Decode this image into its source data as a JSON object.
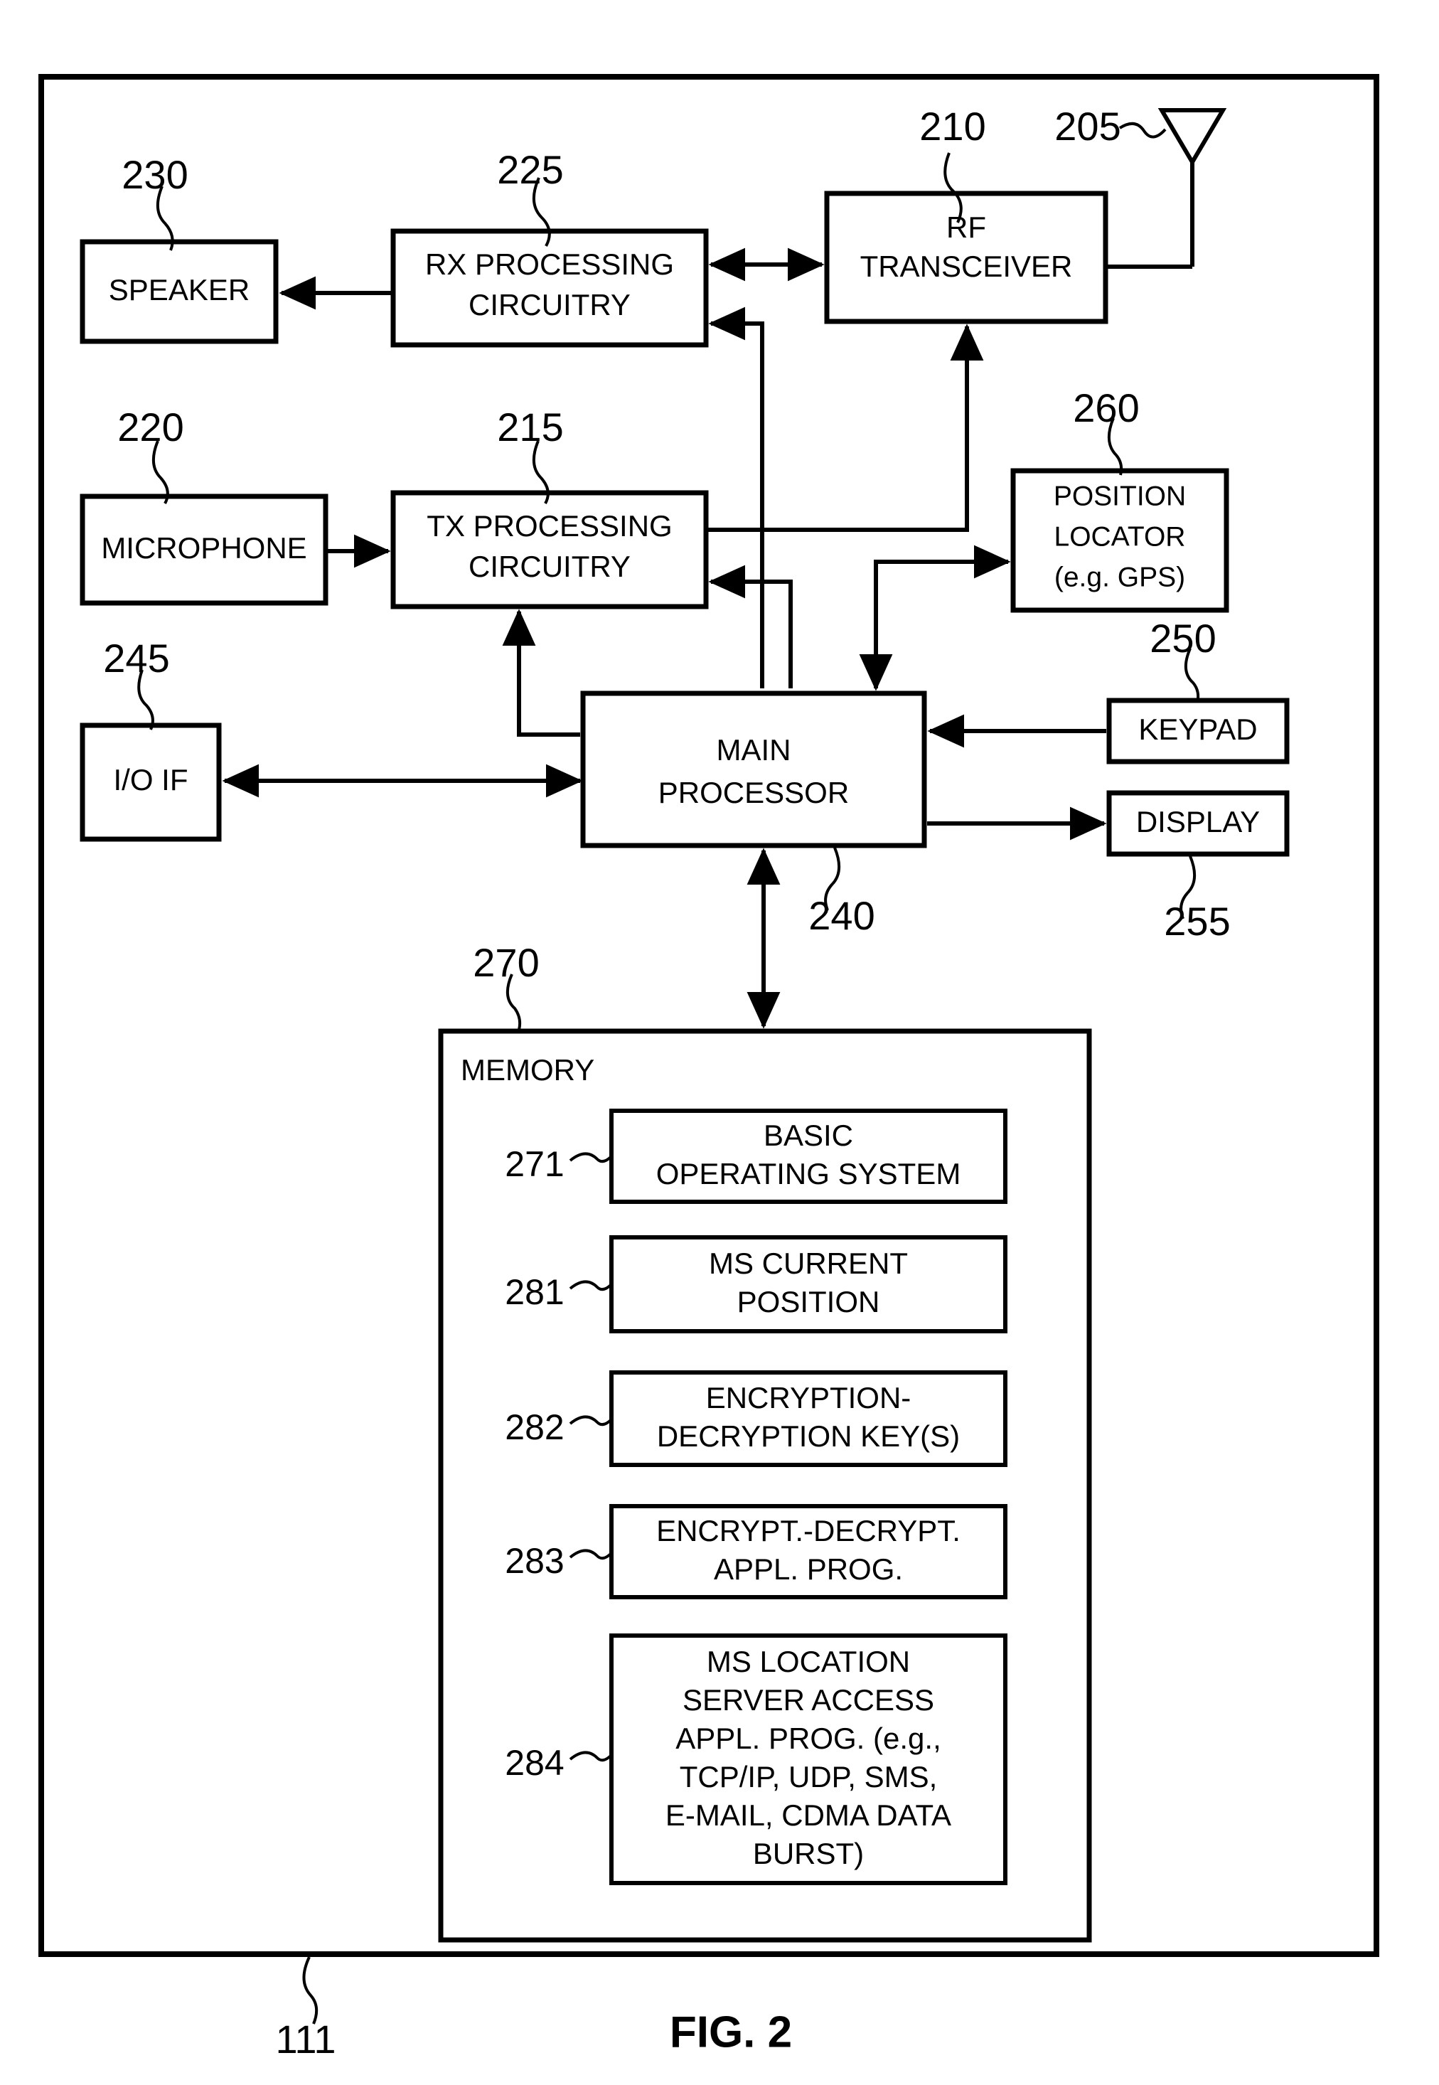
{
  "figure": {
    "caption": "FIG. 2",
    "device_ref": "111"
  },
  "blocks": {
    "antenna": {
      "ref": "205",
      "label": ""
    },
    "rf_transceiver": {
      "ref": "210",
      "line1": "RF",
      "line2": "TRANSCEIVER"
    },
    "rx_processing": {
      "ref": "225",
      "line1": "RX PROCESSING",
      "line2": "CIRCUITRY"
    },
    "speaker": {
      "ref": "230",
      "line1": "SPEAKER"
    },
    "tx_processing": {
      "ref": "215",
      "line1": "TX PROCESSING",
      "line2": "CIRCUITRY"
    },
    "microphone": {
      "ref": "220",
      "line1": "MICROPHONE"
    },
    "position_locator": {
      "ref": "260",
      "line1": "POSITION",
      "line2": "LOCATOR",
      "line3": "(e.g. GPS)"
    },
    "io_if": {
      "ref": "245",
      "line1": "I/O IF"
    },
    "main_processor": {
      "ref": "240",
      "line1": "MAIN",
      "line2": "PROCESSOR"
    },
    "keypad": {
      "ref": "250",
      "line1": "KEYPAD"
    },
    "display": {
      "ref": "255",
      "line1": "DISPLAY"
    },
    "memory": {
      "ref": "270",
      "title": "MEMORY"
    }
  },
  "memory_items": [
    {
      "ref": "271",
      "lines": [
        "BASIC",
        "OPERATING SYSTEM"
      ]
    },
    {
      "ref": "281",
      "lines": [
        "MS CURRENT",
        "POSITION"
      ]
    },
    {
      "ref": "282",
      "lines": [
        "ENCRYPTION-",
        "DECRYPTION KEY(S)"
      ]
    },
    {
      "ref": "283",
      "lines": [
        "ENCRYPT.-DECRYPT.",
        "APPL. PROG."
      ]
    },
    {
      "ref": "284",
      "lines": [
        "MS LOCATION",
        "SERVER ACCESS",
        "APPL. PROG. (e.g.,",
        "TCP/IP, UDP, SMS,",
        "E-MAIL, CDMA DATA",
        "BURST)"
      ]
    }
  ],
  "colors": {
    "ink": "#000000",
    "paper": "#ffffff"
  }
}
